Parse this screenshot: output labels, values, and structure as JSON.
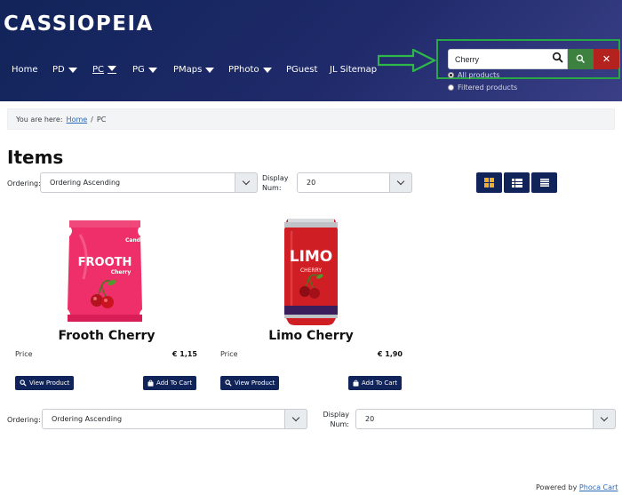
{
  "brand": "CASSIOPEIA",
  "nav": [
    {
      "label": "Home",
      "has_caret": false
    },
    {
      "label": "PD",
      "has_caret": true
    },
    {
      "label": "PC",
      "has_caret": true,
      "active": true
    },
    {
      "label": "PG",
      "has_caret": true
    },
    {
      "label": "PMaps",
      "has_caret": true
    },
    {
      "label": "PPhoto",
      "has_caret": true
    },
    {
      "label": "PGuest",
      "has_caret": false
    },
    {
      "label": "JL Sitemap",
      "has_caret": false
    }
  ],
  "search": {
    "value": "Cherry",
    "radio_all": "All products",
    "radio_filtered": "Filtered products"
  },
  "breadcrumb": {
    "prefix": "You are here:",
    "home": "Home",
    "separator": "/",
    "current": "PC"
  },
  "page_title": "Items",
  "top_controls": {
    "ordering_label": "Ordering:",
    "ordering_value": "Ordering Ascending",
    "display_label": "Display Num:",
    "display_label_line1": "Display",
    "display_label_line2": "Num:",
    "display_value": "20"
  },
  "bottom_controls": {
    "ordering_label": "Ordering:",
    "ordering_value": "Ordering Ascending",
    "display_label_line1": "Display",
    "display_label_line2": "Num:",
    "display_value": "20"
  },
  "view_buttons": [
    "grid-view",
    "list-grid-view",
    "list-view"
  ],
  "products": [
    {
      "name": "Frooth Cherry",
      "package_brand": "FROOTH",
      "package_flavor": "Cherry",
      "package_tag": "Candy",
      "price_label": "Price",
      "price": "€ 1,15",
      "view_label": "View Product",
      "cart_label": "Add To Cart"
    },
    {
      "name": "Limo Cherry",
      "package_brand": "LIMO",
      "package_flavor": "CHERRY",
      "price_label": "Price",
      "price": "€ 1,90",
      "view_label": "View Product",
      "cart_label": "Add To Cart"
    }
  ],
  "footer": {
    "powered_by": "Powered by",
    "link": "Phoca Cart"
  },
  "colors": {
    "header_bg": "#1a2563",
    "accent_navy": "#112459",
    "search_green": "#3d8141",
    "clear_red": "#b3221e",
    "highlight_green": "#28a745",
    "view_grid_icon": "#f0ad2e"
  }
}
